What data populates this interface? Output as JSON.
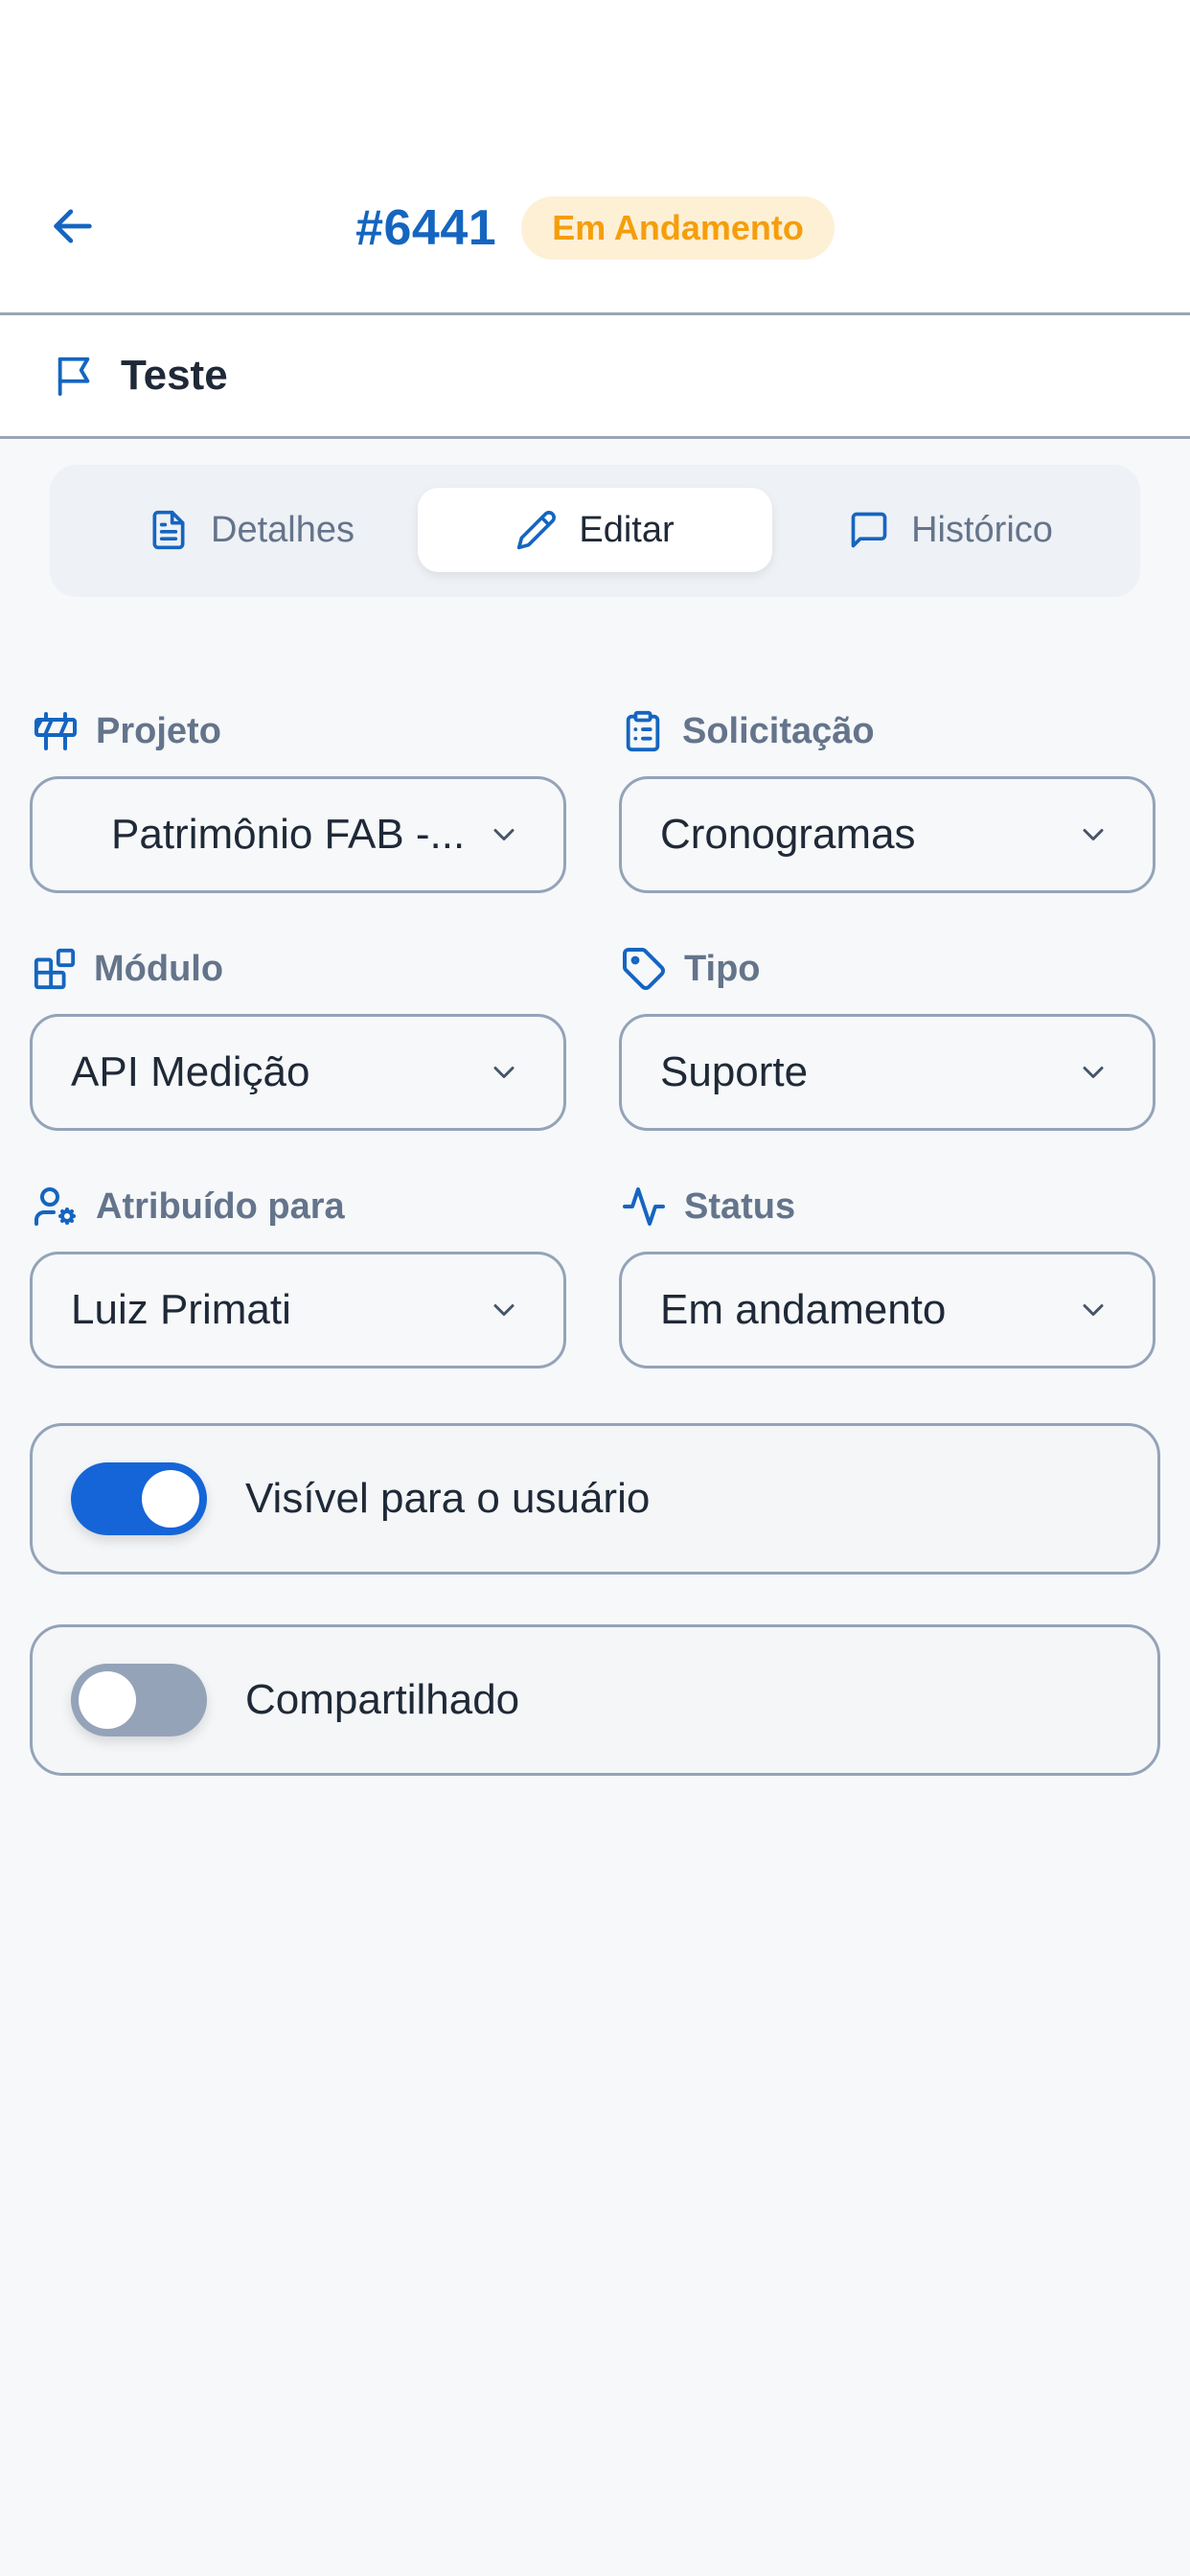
{
  "header": {
    "ticket_id": "#6441",
    "status_badge": "Em Andamento"
  },
  "subject": "Teste",
  "tabs": [
    {
      "label": "Detalhes",
      "icon": "document-icon",
      "active": false
    },
    {
      "label": "Editar",
      "icon": "pencil-icon",
      "active": true
    },
    {
      "label": "Histórico",
      "icon": "chat-icon",
      "active": false
    }
  ],
  "form": {
    "projeto": {
      "label": "Projeto",
      "value": "Patrimônio FAB -...",
      "icon": "barrier-icon"
    },
    "solicitacao": {
      "label": "Solicitação",
      "value": "Cronogramas",
      "icon": "clipboard-icon"
    },
    "modulo": {
      "label": "Módulo",
      "value": "API Medição",
      "icon": "modules-icon"
    },
    "tipo": {
      "label": "Tipo",
      "value": "Suporte",
      "icon": "tag-icon"
    },
    "atribuido": {
      "label": "Atribuído para",
      "value": "Luiz Primati",
      "icon": "user-gear-icon"
    },
    "status": {
      "label": "Status",
      "value": "Em andamento",
      "icon": "activity-icon"
    }
  },
  "toggles": {
    "visivel": {
      "label": "Visível para o usuário",
      "on": true
    },
    "compartilhado": {
      "label": "Compartilhado",
      "on": false
    }
  },
  "colors": {
    "accent": "#1565c0",
    "badge_bg": "#fdf0d5",
    "badge_text": "#f59e0b",
    "border": "#94a3b8",
    "label_text": "#64748b"
  }
}
